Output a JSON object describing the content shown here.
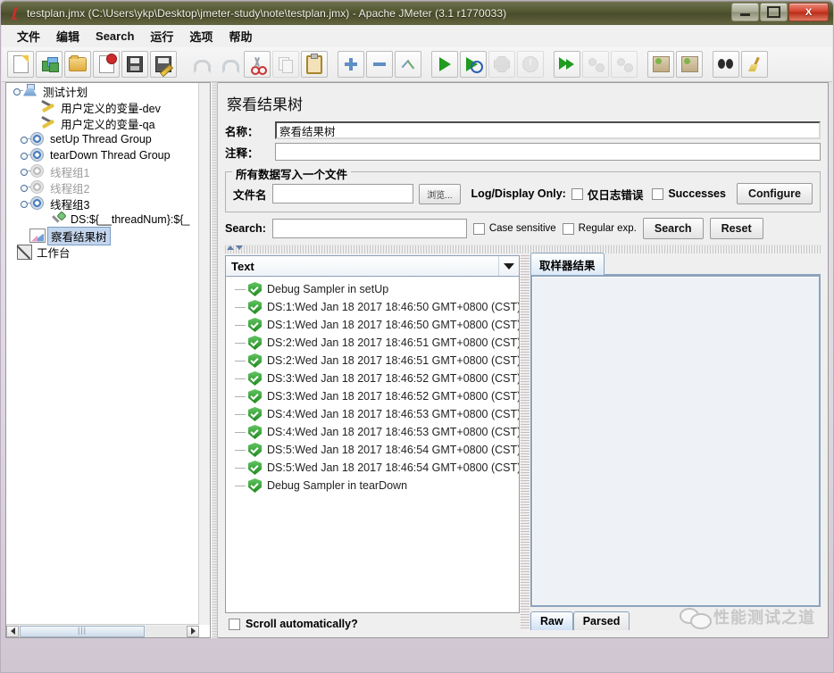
{
  "window": {
    "title": "testplan.jmx (C:\\Users\\ykp\\Desktop\\jmeter-study\\note\\testplan.jmx) - Apache JMeter (3.1 r1770033)",
    "app_icon": "jmeter-feather-icon",
    "minimize_label": "",
    "maximize_label": "",
    "close_label": "X",
    "titlebar_color": "#545832",
    "accent_color": "#2b5fb0"
  },
  "menu": {
    "items": [
      {
        "label": "文件",
        "name": "menu-file"
      },
      {
        "label": "编辑",
        "name": "menu-edit"
      },
      {
        "label": "Search",
        "name": "menu-search"
      },
      {
        "label": "运行",
        "name": "menu-run"
      },
      {
        "label": "选项",
        "name": "menu-options"
      },
      {
        "label": "帮助",
        "name": "menu-help"
      }
    ]
  },
  "toolbar": {
    "buttons": [
      {
        "name": "new-test-plan-icon",
        "icon": "new-page"
      },
      {
        "name": "templates-icon",
        "icon": "templates"
      },
      {
        "name": "open-icon",
        "icon": "folder-open"
      },
      {
        "name": "close-icon",
        "icon": "page-close"
      },
      {
        "name": "save-icon",
        "icon": "floppy-disk"
      },
      {
        "name": "save-as-icon",
        "icon": "floppy-pencil"
      },
      {
        "name": "undo-icon",
        "icon": "undo",
        "disabled": true
      },
      {
        "name": "redo-icon",
        "icon": "redo",
        "disabled": true
      },
      {
        "name": "cut-icon",
        "icon": "scissors"
      },
      {
        "name": "copy-icon",
        "icon": "copy",
        "disabled": true
      },
      {
        "name": "paste-icon",
        "icon": "clipboard"
      },
      {
        "name": "expand-all-icon",
        "icon": "plus"
      },
      {
        "name": "collapse-all-icon",
        "icon": "minus"
      },
      {
        "name": "toggle-icon",
        "icon": "toggle-arrows"
      },
      {
        "name": "start-icon",
        "icon": "play"
      },
      {
        "name": "start-no-pauses-icon",
        "icon": "play-no-pause"
      },
      {
        "name": "stop-icon",
        "icon": "stop",
        "disabled": true
      },
      {
        "name": "shutdown-icon",
        "icon": "shutdown",
        "disabled": true
      },
      {
        "name": "start-remote-all-icon",
        "icon": "play-remote"
      },
      {
        "name": "stop-remote-all-icon",
        "icon": "dots-stop",
        "disabled": true
      },
      {
        "name": "shutdown-remote-all-icon",
        "icon": "dots-shutdown",
        "disabled": true
      },
      {
        "name": "clear-icon",
        "icon": "brush-clear"
      },
      {
        "name": "clear-all-icon",
        "icon": "brush-clear-all"
      },
      {
        "name": "search-icon",
        "icon": "binoculars"
      },
      {
        "name": "reset-search-icon",
        "icon": "broom"
      }
    ]
  },
  "tree": {
    "nodes": [
      {
        "label": "测试计划",
        "icon": "test-plan-icon",
        "indent": 0,
        "handle": "expanded",
        "disabled": false,
        "selected": false
      },
      {
        "label": "用户定义的变量-dev",
        "icon": "config-tools-icon",
        "indent": 20,
        "handle": "none",
        "disabled": false,
        "selected": false
      },
      {
        "label": "用户定义的变量-qa",
        "icon": "config-tools-icon",
        "indent": 20,
        "handle": "none",
        "disabled": false,
        "selected": false
      },
      {
        "label": "setUp Thread Group",
        "icon": "thread-group-icon",
        "indent": 20,
        "handle": "collapsed",
        "disabled": false,
        "selected": false
      },
      {
        "label": "tearDown Thread Group",
        "icon": "thread-group-icon",
        "indent": 20,
        "handle": "collapsed",
        "disabled": false,
        "selected": false
      },
      {
        "label": "线程组1",
        "icon": "thread-group-icon",
        "indent": 20,
        "handle": "collapsed",
        "disabled": true,
        "selected": false
      },
      {
        "label": "线程组2",
        "icon": "thread-group-icon",
        "indent": 20,
        "handle": "collapsed",
        "disabled": true,
        "selected": false
      },
      {
        "label": "线程组3",
        "icon": "thread-group-icon",
        "indent": 20,
        "handle": "expanded",
        "disabled": false,
        "selected": false
      },
      {
        "label": "DS:${__threadNum}:${_",
        "icon": "debug-sampler-icon",
        "indent": 44,
        "handle": "none",
        "disabled": false,
        "selected": false
      },
      {
        "label": "察看结果树",
        "icon": "view-results-tree-icon",
        "indent": 20,
        "handle": "none",
        "disabled": false,
        "selected": true
      },
      {
        "label": "工作台",
        "icon": "workbench-icon",
        "indent": 0,
        "handle": "none",
        "disabled": false,
        "selected": false
      }
    ],
    "hscroll": {
      "left_arrow": "◀",
      "right_arrow": "▶"
    }
  },
  "panel": {
    "title": "察看结果树",
    "name_label": "名称：",
    "name_value": "察看结果树",
    "comment_label": "注释：",
    "comment_value": "",
    "file_group": {
      "title": "所有数据写入一个文件",
      "filename_label": "文件名",
      "filename_value": "",
      "filename_placeholder": "",
      "browse_button": "浏览...",
      "logdisplay_label": "Log/Display Only:",
      "errors_checkbox": "仅日志错误",
      "errors_checked": false,
      "successes_checkbox": "Successes",
      "successes_checked": false,
      "configure_button": "Configure"
    },
    "search_bar": {
      "label": "Search:",
      "value": "",
      "case_sensitive_label": "Case sensitive",
      "case_sensitive_checked": false,
      "regular_exp_label": "Regular exp.",
      "regular_exp_checked": false,
      "search_button": "Search",
      "reset_button": "Reset"
    },
    "renderer": {
      "selected": "Text"
    },
    "results": [
      {
        "label": "Debug Sampler in setUp",
        "status": "success"
      },
      {
        "label": "DS:1:Wed Jan 18 2017 18:46:50 GMT+0800 (CST)",
        "status": "success"
      },
      {
        "label": "DS:1:Wed Jan 18 2017 18:46:50 GMT+0800 (CST)",
        "status": "success"
      },
      {
        "label": "DS:2:Wed Jan 18 2017 18:46:51 GMT+0800 (CST)",
        "status": "success"
      },
      {
        "label": "DS:2:Wed Jan 18 2017 18:46:51 GMT+0800 (CST)",
        "status": "success"
      },
      {
        "label": "DS:3:Wed Jan 18 2017 18:46:52 GMT+0800 (CST)",
        "status": "success"
      },
      {
        "label": "DS:3:Wed Jan 18 2017 18:46:52 GMT+0800 (CST)",
        "status": "success"
      },
      {
        "label": "DS:4:Wed Jan 18 2017 18:46:53 GMT+0800 (CST)",
        "status": "success"
      },
      {
        "label": "DS:4:Wed Jan 18 2017 18:46:53 GMT+0800 (CST)",
        "status": "success"
      },
      {
        "label": "DS:5:Wed Jan 18 2017 18:46:54 GMT+0800 (CST)",
        "status": "success"
      },
      {
        "label": "DS:5:Wed Jan 18 2017 18:46:54 GMT+0800 (CST)",
        "status": "success"
      },
      {
        "label": "Debug Sampler in tearDown",
        "status": "success"
      }
    ],
    "scroll_automatically_label": "Scroll automatically?",
    "scroll_automatically_checked": false,
    "sampler_result_tab": "取样器结果",
    "sampler_result_body": "",
    "bottom_tabs": [
      {
        "label": "Raw",
        "active": true
      },
      {
        "label": "Parsed",
        "active": false
      }
    ]
  },
  "watermark": {
    "text": "性能测试之道",
    "icon": "wechat-bubbles-icon"
  }
}
